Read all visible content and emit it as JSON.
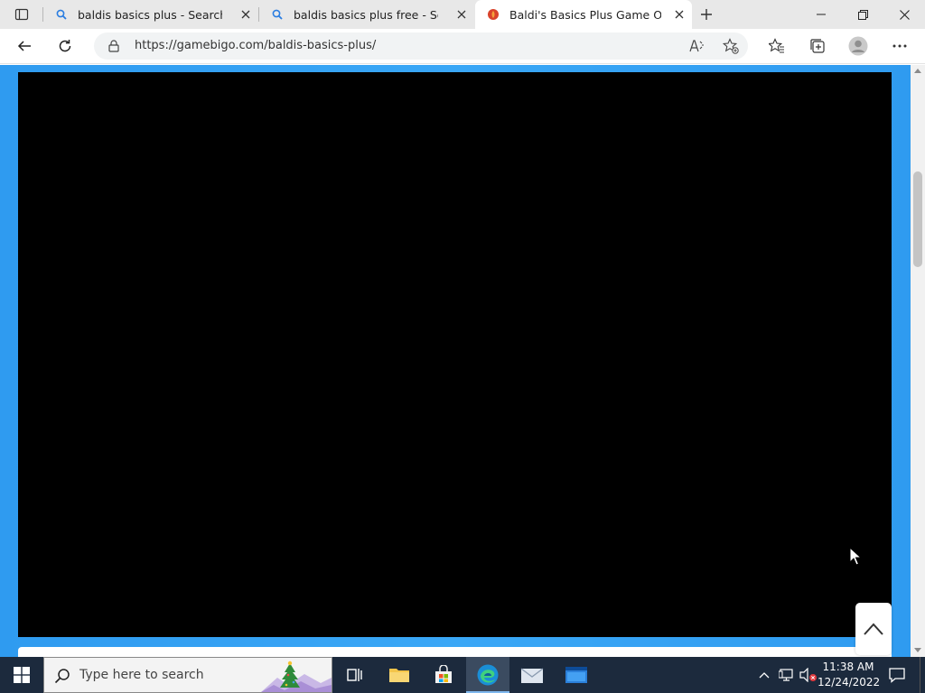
{
  "browser": {
    "tabs": [
      {
        "title": "baldis basics plus - Search",
        "icon": "search-icon",
        "active": false
      },
      {
        "title": "baldis basics plus free - Search",
        "icon": "search-icon",
        "active": false
      },
      {
        "title": "Baldi's Basics Plus Game Online - ",
        "icon": "site-favicon",
        "active": true
      }
    ],
    "url": "https://gamebigo.com/baldis-basics-plus/"
  },
  "page": {
    "background_color": "#3aa7f6",
    "game_area_color": "#000000"
  },
  "taskbar": {
    "search_placeholder": "Type here to search",
    "clock_time": "11:38 AM",
    "clock_date": "12/24/2022"
  },
  "colors": {
    "accent": "#0078d4",
    "taskbar": "#1c2a3d"
  }
}
